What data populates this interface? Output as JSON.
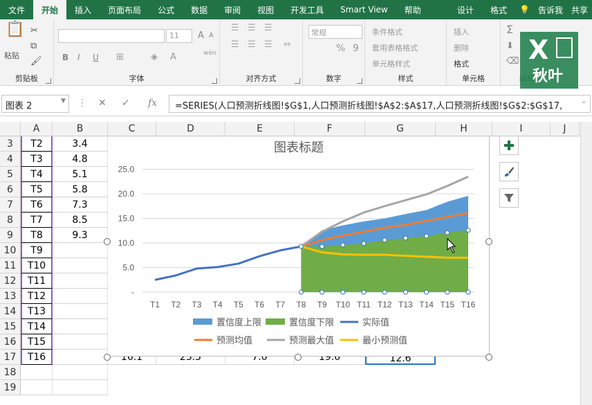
{
  "tabs": [
    {
      "label": "文件",
      "active": false
    },
    {
      "label": "开始",
      "active": true
    },
    {
      "label": "插入",
      "active": false
    },
    {
      "label": "页面布局",
      "active": false
    },
    {
      "label": "公式",
      "active": false
    },
    {
      "label": "数据",
      "active": false
    },
    {
      "label": "审阅",
      "active": false
    },
    {
      "label": "视图",
      "active": false
    },
    {
      "label": "开发工具",
      "active": false
    },
    {
      "label": "Smart View",
      "active": false
    },
    {
      "label": "帮助",
      "active": false
    },
    {
      "label": "设计",
      "active": false
    },
    {
      "label": "格式",
      "active": false
    }
  ],
  "tellme": "告诉我",
  "share": "共享",
  "ribbon": {
    "clipboard": {
      "label": "剪贴板",
      "paste": "粘贴"
    },
    "font": {
      "label": "字体",
      "size": "11",
      "bold": "B",
      "italic": "I",
      "underline": "U",
      "grow": "A",
      "shrink": "A",
      "wen": "wén"
    },
    "alignment": {
      "label": "对齐方式"
    },
    "number": {
      "label": "数字",
      "format": "常规",
      "percent": "%",
      "comma": "9"
    },
    "styles": {
      "label": "样式",
      "items": [
        "条件格式",
        "套用表格格式",
        "单元格样式"
      ]
    },
    "cells": {
      "label": "单元格",
      "items": [
        "插入",
        "删除",
        "格式"
      ]
    },
    "editing": {
      "label": "编辑"
    }
  },
  "logo": {
    "x": "X",
    "text": "秋叶"
  },
  "formula_bar": {
    "name_box": "图表 2",
    "formula": "=SERIES(人口预测折线图!$G$1,人口预测折线图!$A$2:$A$17,人口预测折线图!$G$2:$G$17,"
  },
  "columns": [
    "A",
    "B",
    "C",
    "D",
    "E",
    "F",
    "G",
    "H",
    "I",
    "J"
  ],
  "rows": [
    {
      "num": "3",
      "a": "T2",
      "b": "3.4"
    },
    {
      "num": "4",
      "a": "T3",
      "b": "4.8"
    },
    {
      "num": "5",
      "a": "T4",
      "b": "5.1"
    },
    {
      "num": "6",
      "a": "T5",
      "b": "5.8"
    },
    {
      "num": "7",
      "a": "T6",
      "b": "7.3"
    },
    {
      "num": "8",
      "a": "T7",
      "b": "8.5"
    },
    {
      "num": "9",
      "a": "T8",
      "b": "9.3"
    },
    {
      "num": "10",
      "a": "T9",
      "b": ""
    },
    {
      "num": "11",
      "a": "T10",
      "b": ""
    },
    {
      "num": "12",
      "a": "T11",
      "b": ""
    },
    {
      "num": "13",
      "a": "T12",
      "b": ""
    },
    {
      "num": "14",
      "a": "T13",
      "b": ""
    },
    {
      "num": "15",
      "a": "T14",
      "b": ""
    },
    {
      "num": "16",
      "a": "T15",
      "b": ""
    },
    {
      "num": "17",
      "a": "T16",
      "b": ""
    },
    {
      "num": "18",
      "a": "",
      "b": ""
    },
    {
      "num": "19",
      "a": "",
      "b": ""
    }
  ],
  "row17_partial": {
    "c": "16.1",
    "d": "23.5",
    "e": "7.0",
    "f": "19.6",
    "g": "12.6"
  },
  "colors": {
    "ribbon_green": "#217346",
    "band_upper": "#5b9bd5",
    "band_lower": "#70ad47",
    "actual": "#4472c4",
    "mean": "#ed7d31",
    "max": "#a5a5a5",
    "min": "#ffc000"
  },
  "chart_data": {
    "type": "line",
    "title": "图表标题",
    "categories": [
      "T1",
      "T2",
      "T3",
      "T4",
      "T5",
      "T6",
      "T7",
      "T8",
      "T9",
      "T10",
      "T11",
      "T12",
      "T13",
      "T14",
      "T15",
      "T16"
    ],
    "ylim": [
      0,
      25
    ],
    "yticks": [
      "-",
      "5.0",
      "10.0",
      "15.0",
      "20.0",
      "25.0"
    ],
    "grid": true,
    "legend_position": "bottom",
    "series": [
      {
        "name": "置信度上限",
        "kind": "area",
        "values": [
          null,
          null,
          null,
          null,
          null,
          null,
          null,
          9.3,
          12.6,
          13.6,
          14.4,
          15.0,
          15.9,
          16.7,
          18.4,
          19.6
        ]
      },
      {
        "name": "置信度下限",
        "kind": "area",
        "values": [
          null,
          null,
          null,
          null,
          null,
          null,
          null,
          9.3,
          9.3,
          9.6,
          9.9,
          10.6,
          11.0,
          11.4,
          12.1,
          12.6
        ]
      },
      {
        "name": "实际值",
        "kind": "line",
        "values": [
          2.5,
          3.4,
          4.8,
          5.1,
          5.8,
          7.3,
          8.5,
          9.3,
          null,
          null,
          null,
          null,
          null,
          null,
          null,
          null
        ]
      },
      {
        "name": "预测均值",
        "kind": "line",
        "values": [
          null,
          null,
          null,
          null,
          null,
          null,
          null,
          9.3,
          10.6,
          11.5,
          12.3,
          13.1,
          13.7,
          14.5,
          15.3,
          16.1
        ]
      },
      {
        "name": "预测最大值",
        "kind": "line",
        "values": [
          null,
          null,
          null,
          null,
          null,
          null,
          null,
          9.3,
          12.3,
          14.4,
          16.2,
          17.5,
          18.7,
          19.9,
          21.6,
          23.5
        ]
      },
      {
        "name": "最小预测值",
        "kind": "line",
        "values": [
          null,
          null,
          null,
          null,
          null,
          null,
          null,
          9.3,
          8.1,
          7.7,
          7.6,
          7.6,
          7.4,
          7.2,
          7.0,
          7.0
        ]
      }
    ]
  }
}
